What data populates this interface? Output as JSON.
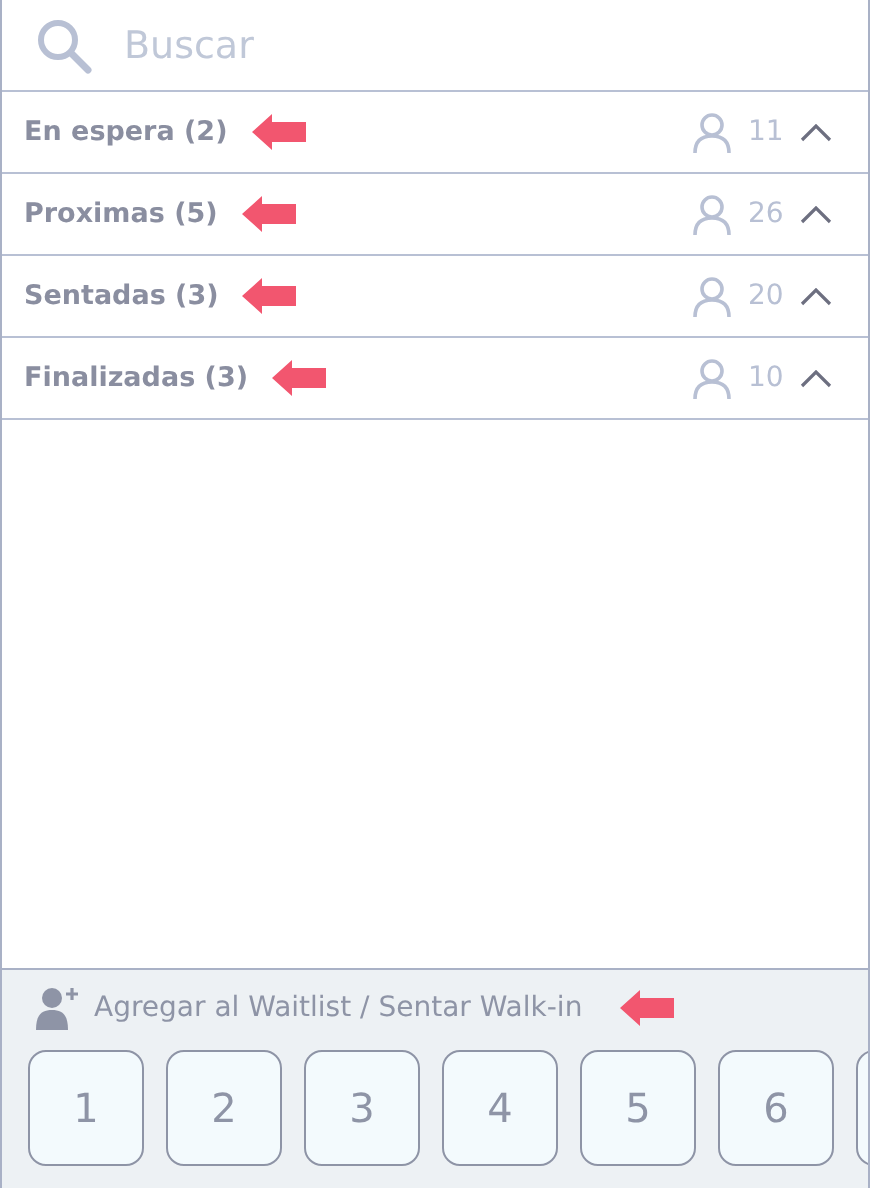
{
  "search": {
    "placeholder": "Buscar"
  },
  "sections": [
    {
      "label": "En espera (2)",
      "guests": "11",
      "expanded": true
    },
    {
      "label": "Proximas (5)",
      "guests": "26",
      "expanded": true
    },
    {
      "label": "Sentadas (3)",
      "guests": "20",
      "expanded": true
    },
    {
      "label": "Finalizadas (3)",
      "guests": "10",
      "expanded": true
    }
  ],
  "footer": {
    "label": "Agregar al Waitlist / Sentar Walk-in",
    "party_sizes": [
      "1",
      "2",
      "3",
      "4",
      "5",
      "6"
    ]
  }
}
